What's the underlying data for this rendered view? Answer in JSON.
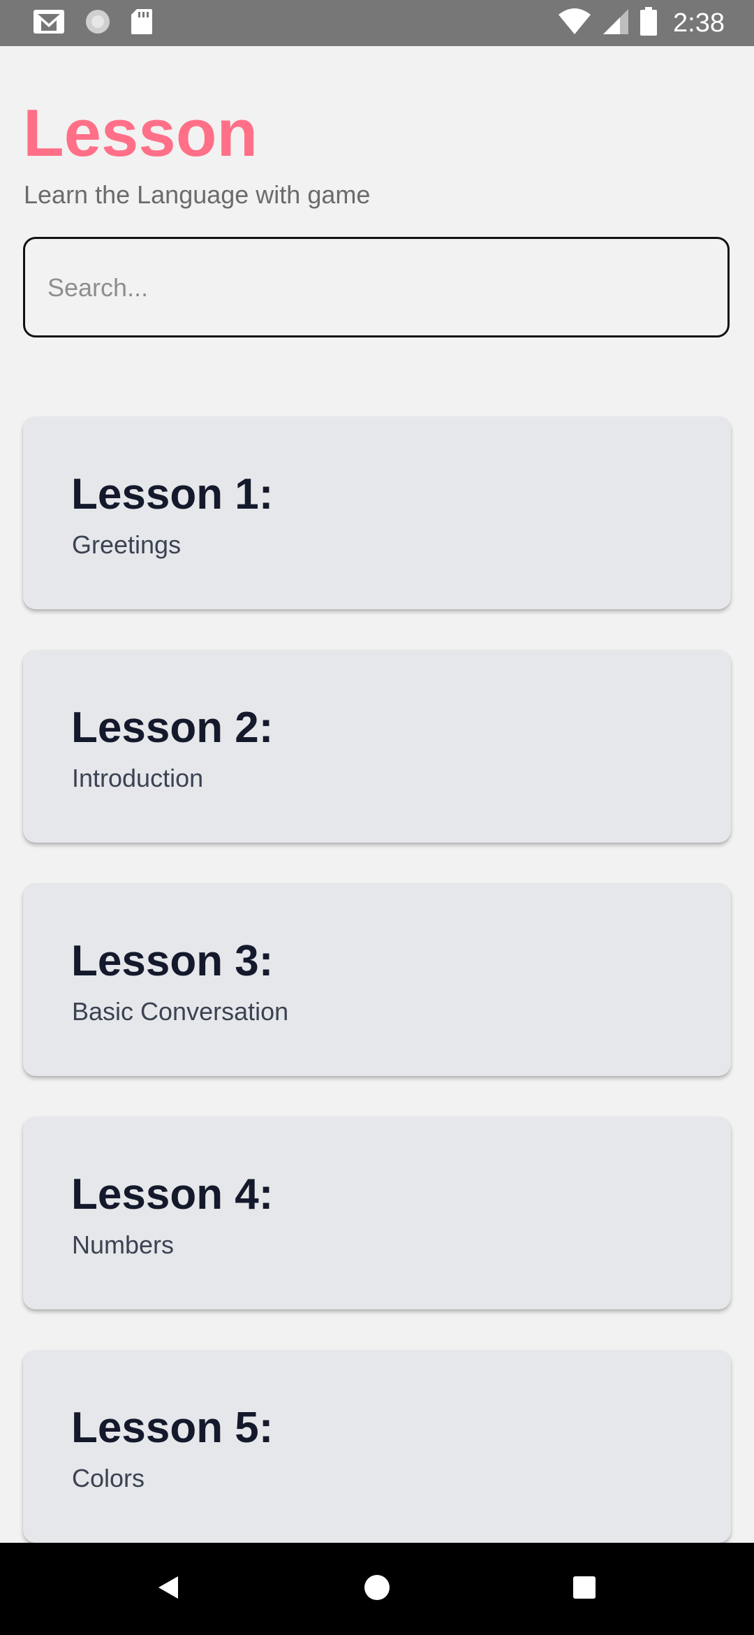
{
  "status_bar": {
    "time": "2:38",
    "icons": [
      "gmail-icon",
      "sync-icon",
      "sd-card-icon",
      "wifi-icon",
      "cellular-signal-icon",
      "battery-icon"
    ]
  },
  "header": {
    "title": "Lesson",
    "subtitle": "Learn the Language with game"
  },
  "search": {
    "placeholder": "Search...",
    "value": ""
  },
  "lessons": [
    {
      "number": "Lesson 1:",
      "name": "Greetings"
    },
    {
      "number": "Lesson 2:",
      "name": "Introduction"
    },
    {
      "number": "Lesson 3:",
      "name": "Basic Conversation"
    },
    {
      "number": "Lesson 4:",
      "name": "Numbers"
    },
    {
      "number": "Lesson 5:",
      "name": "Colors"
    }
  ],
  "nav_bar": {
    "icons": [
      "back-icon",
      "home-icon",
      "recents-icon"
    ]
  },
  "colors": {
    "accent": "#ff7088",
    "background": "#f2f2f2",
    "card": "#e6e7ea",
    "status_bar": "#777777",
    "nav_bar": "#000000"
  }
}
